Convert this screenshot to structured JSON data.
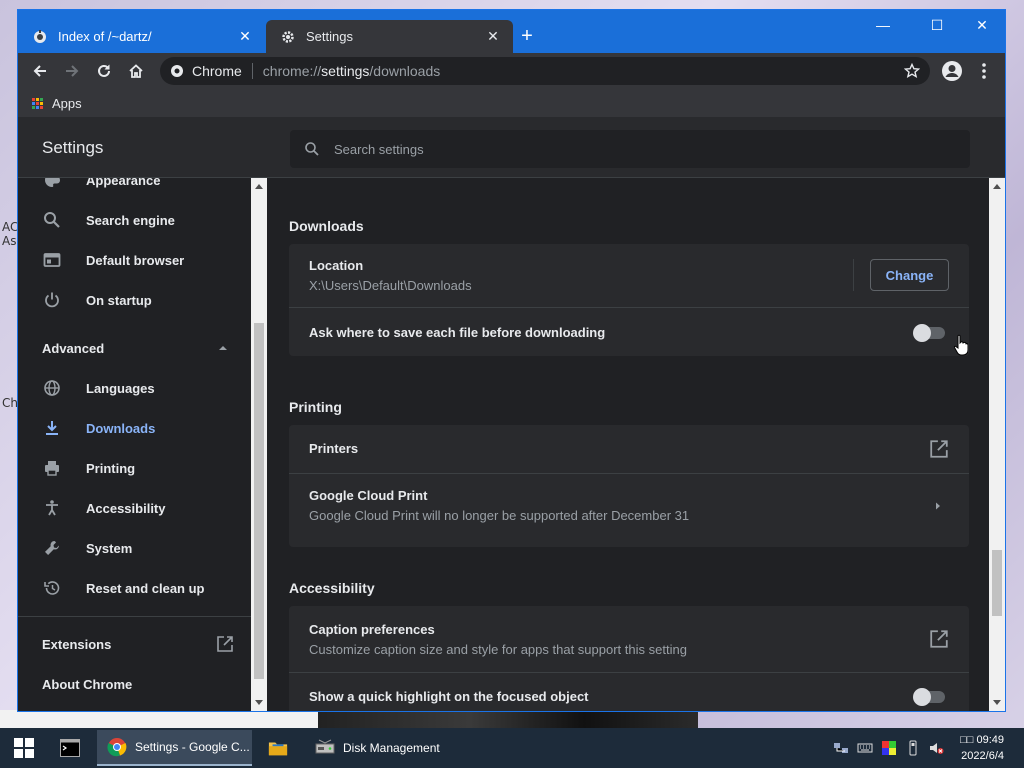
{
  "desktop": {
    "left_texts": [
      "AC",
      "As",
      "Ch"
    ]
  },
  "browser": {
    "tabs": [
      {
        "title": "Index of /~dartz/",
        "active": false
      },
      {
        "title": "Settings",
        "active": true
      }
    ],
    "new_tab_label": "+",
    "window_controls": {
      "minimize": "—",
      "maximize": "☐",
      "close": "✕"
    },
    "omnibox": {
      "site_chip": "Chrome",
      "url_scheme": "chrome://",
      "url_host": "settings",
      "url_path": "/downloads"
    },
    "bookmarks": [
      {
        "label": "Apps"
      }
    ]
  },
  "settings": {
    "title": "Settings",
    "search_placeholder": "Search settings",
    "sidebar": {
      "items": [
        {
          "label": "Appearance",
          "icon": "palette-icon"
        },
        {
          "label": "Search engine",
          "icon": "search-icon"
        },
        {
          "label": "Default browser",
          "icon": "browser-icon"
        },
        {
          "label": "On startup",
          "icon": "power-icon"
        }
      ],
      "advanced_label": "Advanced",
      "advanced_items": [
        {
          "label": "Languages",
          "icon": "globe-icon"
        },
        {
          "label": "Downloads",
          "icon": "download-icon",
          "selected": true
        },
        {
          "label": "Printing",
          "icon": "printer-icon"
        },
        {
          "label": "Accessibility",
          "icon": "accessibility-icon"
        },
        {
          "label": "System",
          "icon": "wrench-icon"
        },
        {
          "label": "Reset and clean up",
          "icon": "restore-icon"
        }
      ],
      "extensions_label": "Extensions",
      "about_label": "About Chrome"
    },
    "sections": {
      "downloads": {
        "title": "Downloads",
        "location_title": "Location",
        "location_path": "X:\\Users\\Default\\Downloads",
        "change_button": "Change",
        "ask_where_label": "Ask where to save each file before downloading",
        "ask_where_enabled": false
      },
      "printing": {
        "title": "Printing",
        "printers_label": "Printers",
        "cloud_print_title": "Google Cloud Print",
        "cloud_print_sub": "Google Cloud Print will no longer be supported after December 31"
      },
      "accessibility": {
        "title": "Accessibility",
        "caption_title": "Caption preferences",
        "caption_sub": "Customize caption size and style for apps that support this setting",
        "highlight_label": "Show a quick highlight on the focused object",
        "highlight_enabled": false
      }
    }
  },
  "taskbar": {
    "apps": [
      {
        "label": "",
        "icon": "terminal-icon"
      },
      {
        "label": "Settings - Google C...",
        "icon": "chrome-icon",
        "active": true
      },
      {
        "label": "",
        "icon": "folder-icon"
      },
      {
        "label": "Disk Management",
        "icon": "disk-icon"
      }
    ],
    "clock_time": "□□ 09:49",
    "clock_date": "2022/6/4"
  }
}
